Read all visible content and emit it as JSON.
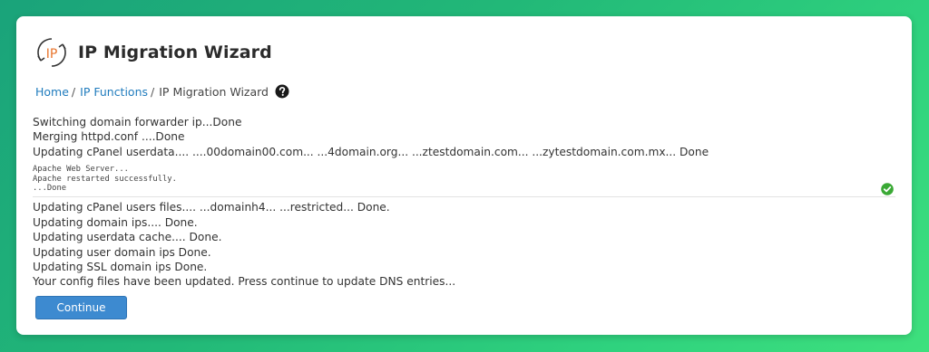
{
  "header": {
    "logo_text": "IP",
    "title": "IP Migration Wizard"
  },
  "breadcrumb": {
    "items": [
      {
        "label": "Home"
      },
      {
        "label": "IP Functions"
      }
    ],
    "separator": "/",
    "current": "IP Migration Wizard",
    "help_icon": "question-circle-icon"
  },
  "log": {
    "lines_before": [
      "Switching domain forwarder ip...Done",
      "Merging httpd.conf ....Done",
      "Updating cPanel userdata.... ....00domain00.com... ...4domain.org... ...ztestdomain.com... ...zytestdomain.com.mx... Done"
    ],
    "apache_output": [
      "Apache Web Server...",
      "Apache restarted successfully.",
      "...Done"
    ],
    "status_icon": "check-circle-icon",
    "lines_after": [
      "Updating cPanel users files.... ...domainh4... ...restricted... Done.",
      "Updating domain ips.... Done.",
      "Updating userdata cache.... Done.",
      "Updating user domain ips Done.",
      "Updating SSL domain ips Done.",
      "Your config files have been updated. Press continue to update DNS entries..."
    ]
  },
  "actions": {
    "continue_label": "Continue"
  },
  "colors": {
    "accent": "#3d8ad0",
    "link": "#1f7bbd",
    "logo_orange": "#e8742c",
    "success": "#3aa935"
  }
}
